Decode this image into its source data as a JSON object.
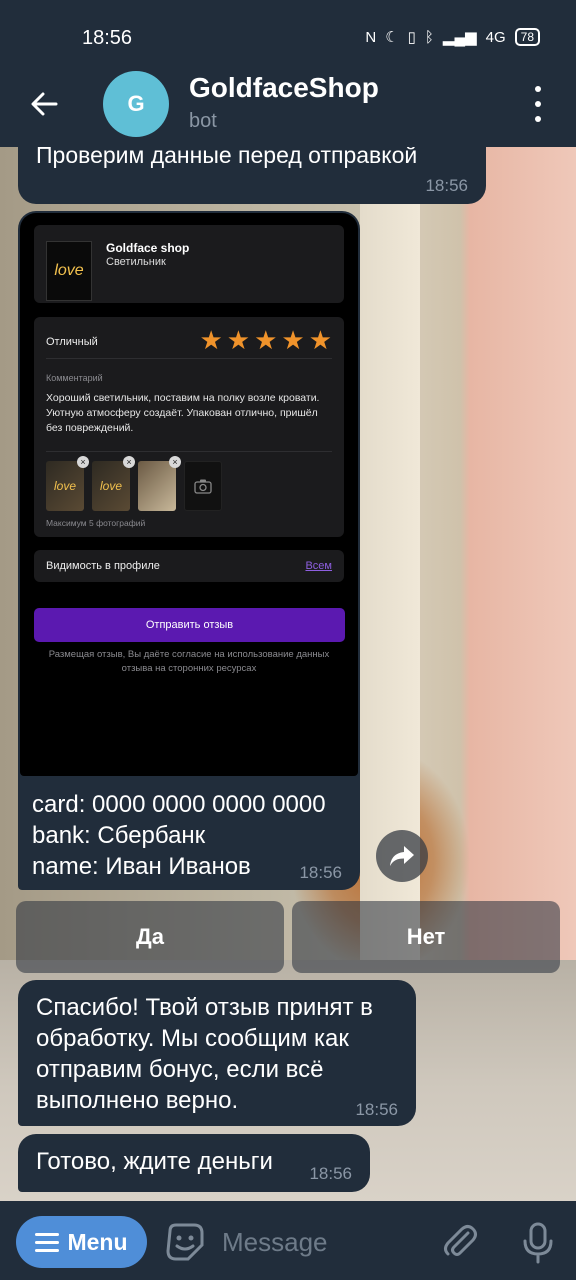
{
  "status_bar": {
    "time": "18:56",
    "network": "4G",
    "battery": "78"
  },
  "header": {
    "avatar_letter": "G",
    "title": "GoldfaceShop",
    "subtitle": "bot"
  },
  "messages": {
    "m1": {
      "text": "Проверим данные перед отправкой",
      "time": "18:56"
    },
    "m2": {
      "screenshot": {
        "shop_name": "Goldface shop",
        "product": "Светильник",
        "product_img_text": "love",
        "rating_label": "Отличный",
        "stars": 5,
        "comment_label": "Комментарий",
        "comment": "Хороший светильник, поставим на полку возле кровати. Уютную атмосферу создаёт. Упакован отлично, пришёл без повреждений.",
        "photos": [
          "love",
          "love",
          ""
        ],
        "photos_hint": "Максимум 5 фотографий",
        "visibility_label": "Видимость в профиле",
        "visibility_value": "Всем",
        "submit": "Отправить отзыв",
        "consent": "Размещая отзыв, Вы даёте согласие на использование данных отзыва на сторонних ресурсах"
      },
      "line1": "card: 0000 0000 0000 0000",
      "line2": "bank: Сбербанк",
      "line3": "name: Иван Иванов",
      "time": "18:56"
    },
    "m3": {
      "text": "Спасибо! Твой отзыв принят в обработку. Мы сообщим как отправим бонус, если всё выполнено верно.",
      "time": "18:56"
    },
    "m4": {
      "text": "Готово, ждите деньги",
      "time": "18:56"
    }
  },
  "keyboard": {
    "yes": "Да",
    "no": "Нет"
  },
  "input_bar": {
    "menu_label": "Menu",
    "placeholder": "Message"
  },
  "colors": {
    "header_bg": "#212d3b",
    "bubble_bg": "#212d3b",
    "menu_accent": "#4f8ed8",
    "star": "#f0932b",
    "submit_purple": "#5b19b0"
  }
}
